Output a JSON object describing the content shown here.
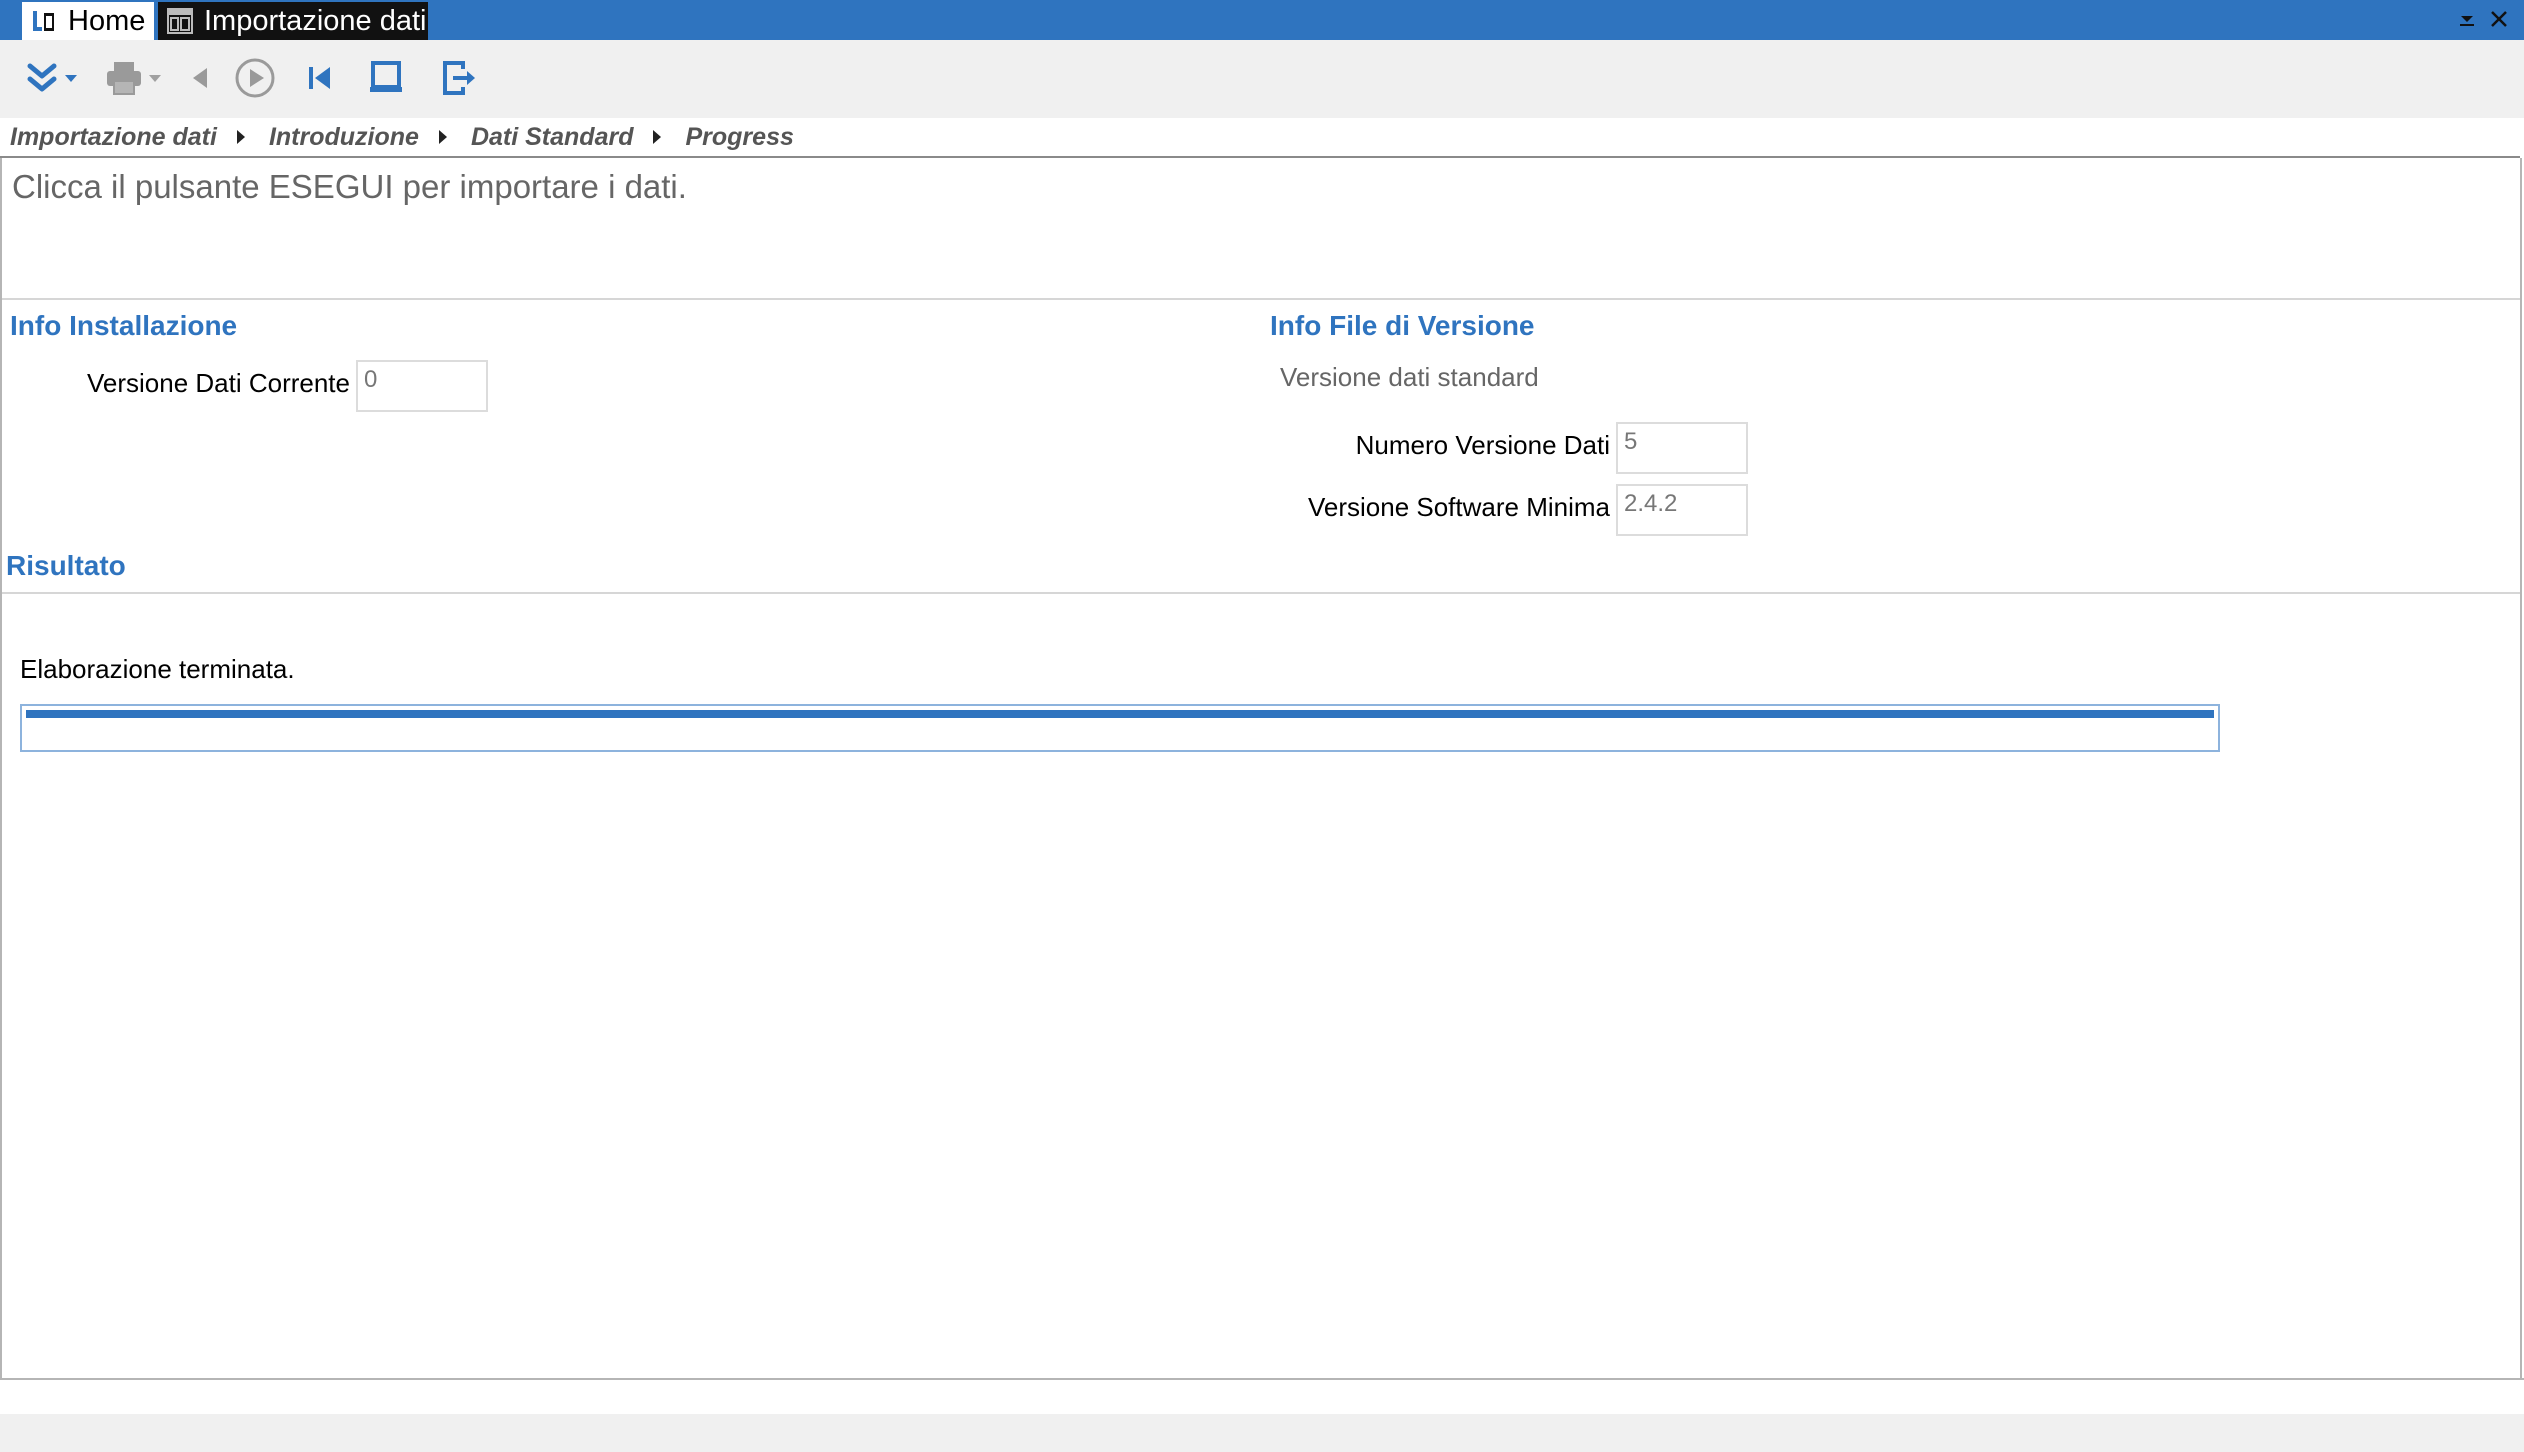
{
  "tabs": [
    {
      "label": "Home",
      "icon": "app-logo-icon"
    },
    {
      "label": "Importazione dati",
      "icon": "table-window-icon"
    }
  ],
  "window_controls": {
    "menu_icon": "chevron-down-icon",
    "close_icon": "close-icon"
  },
  "toolbar": {
    "buttons": [
      {
        "icon": "double-chevron-down-icon",
        "has_dropdown": true
      },
      {
        "icon": "printer-icon",
        "has_dropdown": true
      },
      {
        "icon": "back-arrow-icon"
      },
      {
        "icon": "play-circle-icon"
      },
      {
        "icon": "skip-to-start-icon"
      },
      {
        "icon": "monitor-icon"
      },
      {
        "icon": "exit-icon"
      }
    ]
  },
  "breadcrumb": [
    "Importazione dati",
    "Introduzione",
    "Dati Standard",
    "Progress"
  ],
  "instruction": "Clicca il pulsante ESEGUI per importare i dati.",
  "info_installazione": {
    "title": "Info Installazione",
    "versione_dati_corrente_label": "Versione Dati Corrente",
    "versione_dati_corrente_value": "0"
  },
  "info_file_versione": {
    "title": "Info File di Versione",
    "subtitle": "Versione dati standard",
    "numero_versione_label": "Numero Versione Dati",
    "numero_versione_value": "5",
    "versione_software_label": "Versione Software Minima",
    "versione_software_value": "2.4.2"
  },
  "risultato": {
    "title": "Risultato",
    "status": "Elaborazione terminata.",
    "progress": 1.0
  },
  "colors": {
    "accent": "#2f74bf",
    "titlebar": "#2f74bf",
    "active_tab": "#111111",
    "toolbar_bg": "#f0f0f0"
  }
}
